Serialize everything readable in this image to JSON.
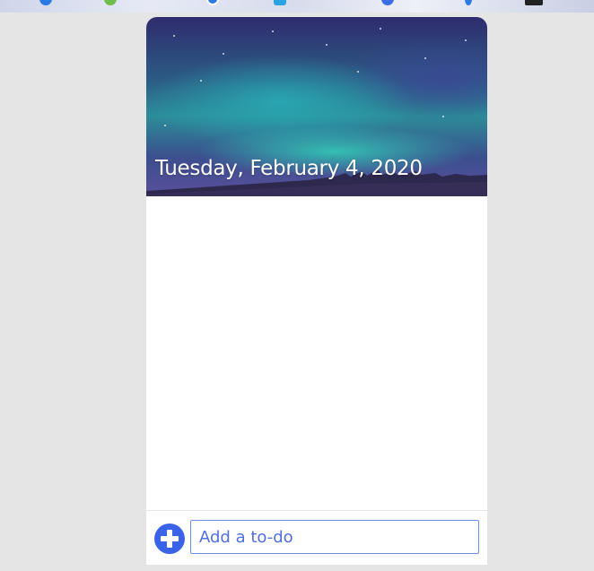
{
  "header": {
    "date": "Tuesday, February 4, 2020"
  },
  "todo_list": {
    "items": []
  },
  "footer": {
    "add_button_icon": "plus-circle-icon",
    "input_placeholder": "Add a to-do",
    "input_value": ""
  },
  "colors": {
    "accent": "#3a63e8",
    "input_border": "#6f8ff0",
    "page_background": "#e5e5e5"
  }
}
